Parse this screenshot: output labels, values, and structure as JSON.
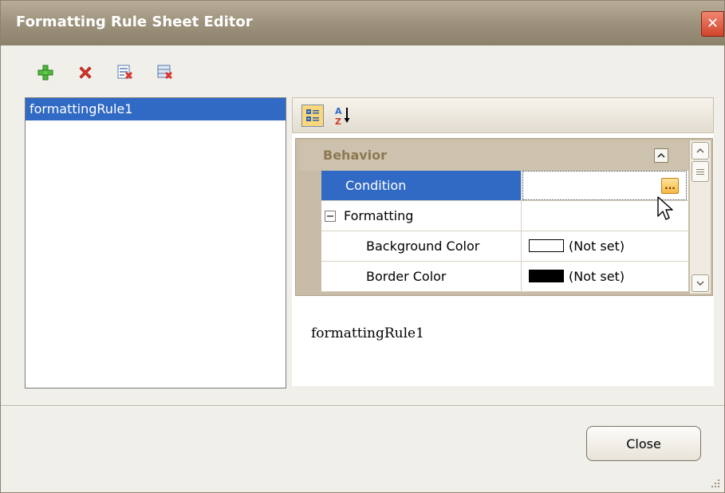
{
  "window": {
    "title": "Formatting Rule Sheet Editor",
    "close_glyph": "✕"
  },
  "toolbar": {
    "icons": [
      "add-icon",
      "delete-icon",
      "remove-rule-icon",
      "clear-rules-icon"
    ]
  },
  "rules_list": {
    "items": [
      "formattingRule1"
    ]
  },
  "property_grid": {
    "toolbar_icons": [
      "categorized-icon",
      "alphabetical-sort-icon"
    ],
    "category": {
      "label": "Behavior"
    },
    "rows": [
      {
        "name": "Condition",
        "value": ""
      },
      {
        "name": "Formatting",
        "value": ""
      },
      {
        "name": "Background Color",
        "value": "(Not set)",
        "swatch": "#ffffff"
      },
      {
        "name": "Border Color",
        "value": "(Not set)",
        "swatch": "#000000"
      }
    ],
    "ellipsis": "..."
  },
  "description": {
    "text": "formattingRule1"
  },
  "footer": {
    "close_label": "Close"
  },
  "colors": {
    "selection": "#316ac5",
    "titlebar": "#9d927c",
    "category_text": "#8c7853"
  }
}
